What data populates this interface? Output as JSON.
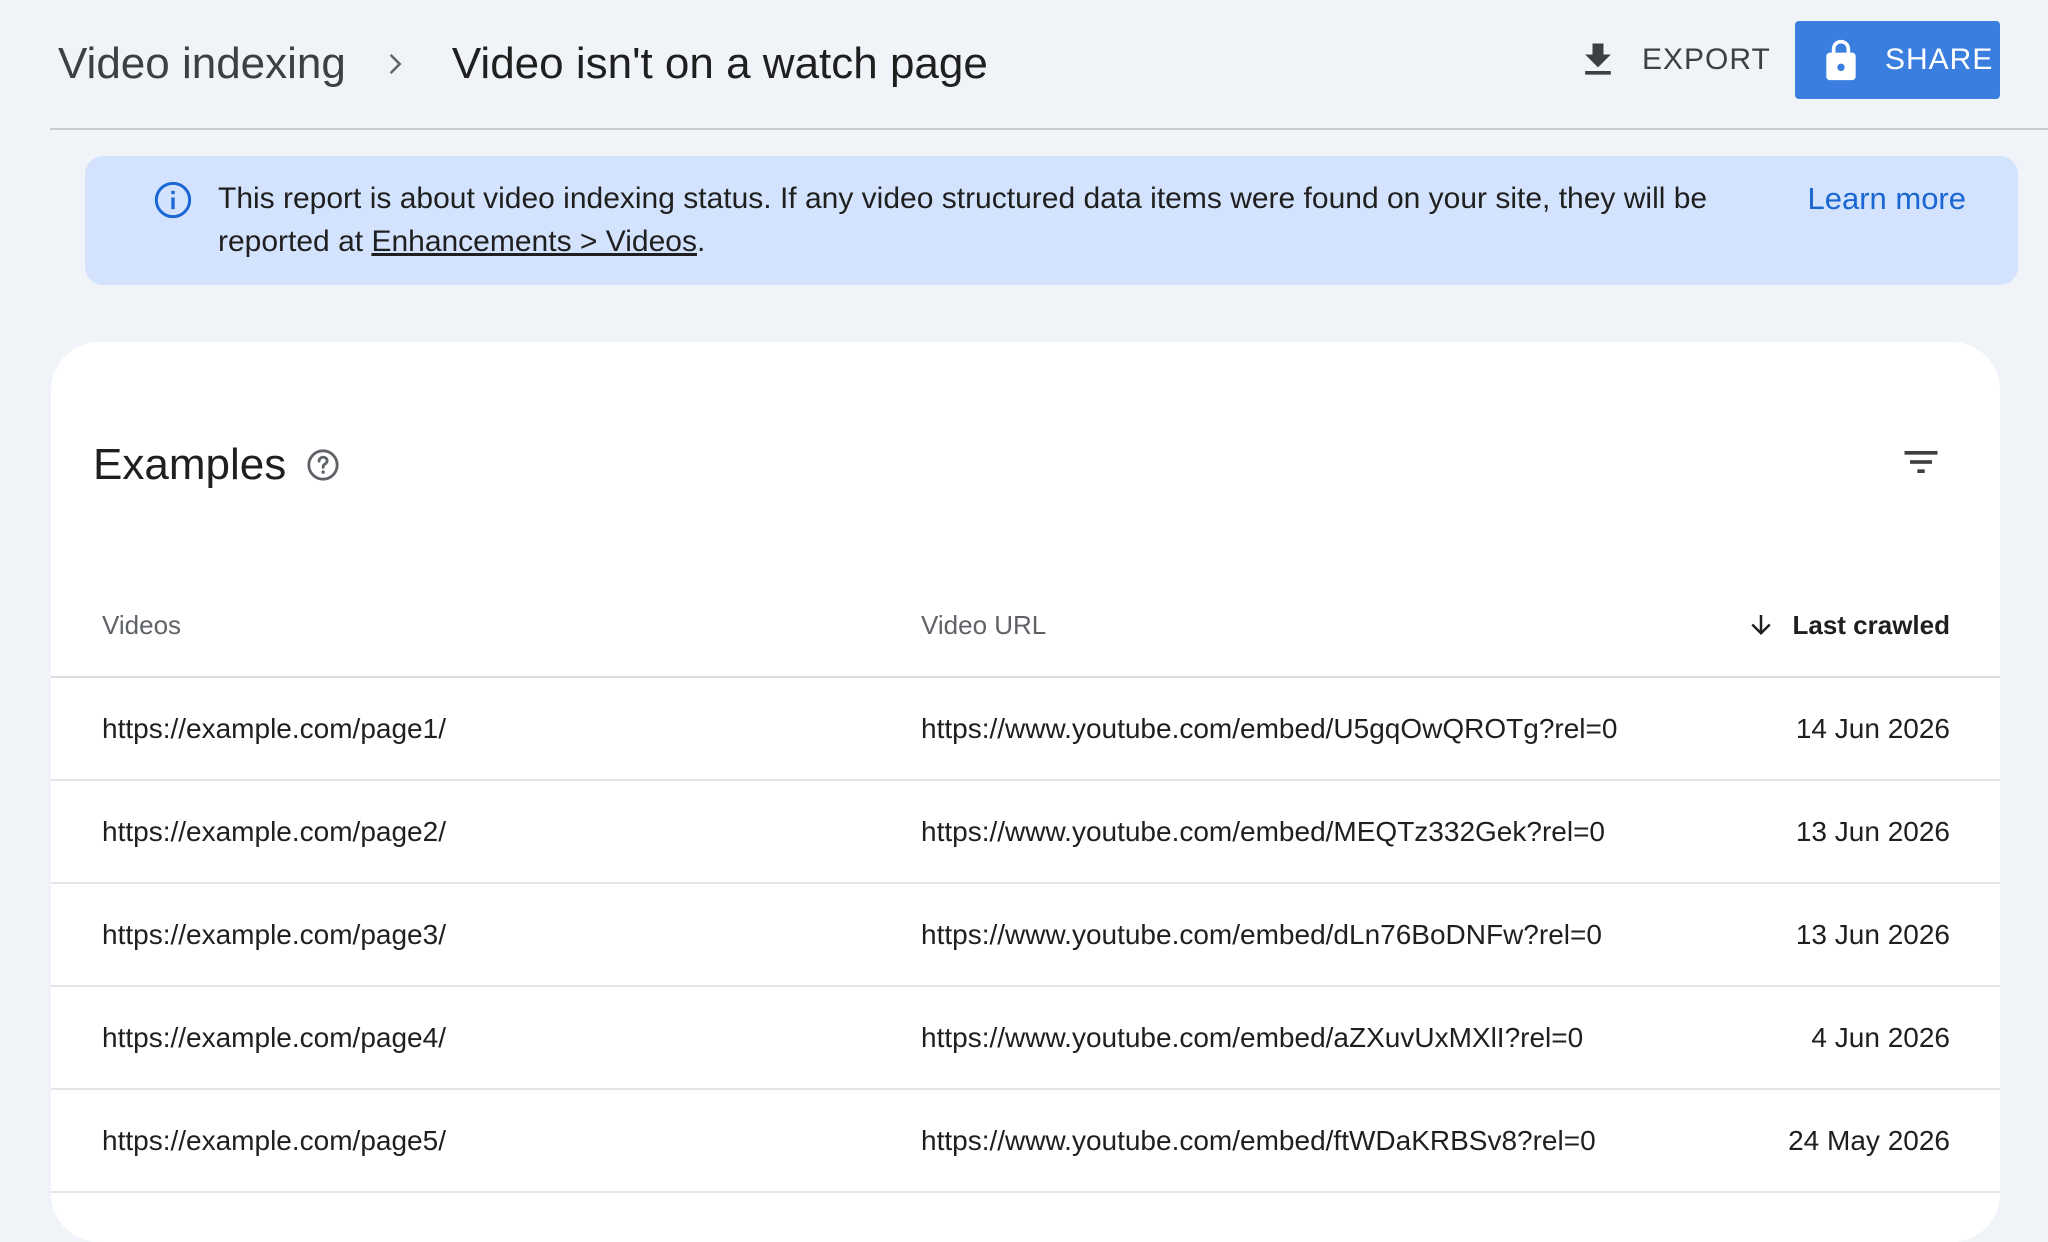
{
  "header": {
    "breadcrumb_parent": "Video indexing",
    "breadcrumb_current": "Video isn't on a watch page",
    "export_label": "EXPORT",
    "share_label": "SHARE",
    "accent_color": "#3a7fe0"
  },
  "banner": {
    "text_before_link": "This report is about video indexing status. If any video structured data items were found on your site, they will be reported at ",
    "link_text": "Enhancements > Videos",
    "text_after_link": ".",
    "learn_more": "Learn more",
    "background_color": "#d3e3fd"
  },
  "examples": {
    "title": "Examples",
    "columns": {
      "videos": "Videos",
      "video_url": "Video URL",
      "last_crawled": "Last crawled"
    },
    "sort": "last_crawled-descending",
    "rows": [
      {
        "page": "https://example.com/page1/",
        "video_url": "https://www.youtube.com/embed/U5gqOwQROTg?rel=0",
        "last_crawled": "14 Jun 2026"
      },
      {
        "page": "https://example.com/page2/",
        "video_url": "https://www.youtube.com/embed/MEQTz332Gek?rel=0",
        "last_crawled": "13 Jun 2026"
      },
      {
        "page": "https://example.com/page3/",
        "video_url": "https://www.youtube.com/embed/dLn76BoDNFw?rel=0",
        "last_crawled": "13 Jun 2026"
      },
      {
        "page": "https://example.com/page4/",
        "video_url": "https://www.youtube.com/embed/aZXuvUxMXlI?rel=0",
        "last_crawled": "4 Jun 2026"
      },
      {
        "page": "https://example.com/page5/",
        "video_url": "https://www.youtube.com/embed/ftWDaKRBSv8?rel=0",
        "last_crawled": "24 May 2026"
      }
    ]
  },
  "icons": {
    "breadcrumb_separator": "chevron-right-icon",
    "export": "download-icon",
    "share": "lock-icon",
    "banner": "info-icon",
    "help": "help-circle-icon",
    "filter": "filter-icon",
    "sort": "arrow-down-icon"
  }
}
